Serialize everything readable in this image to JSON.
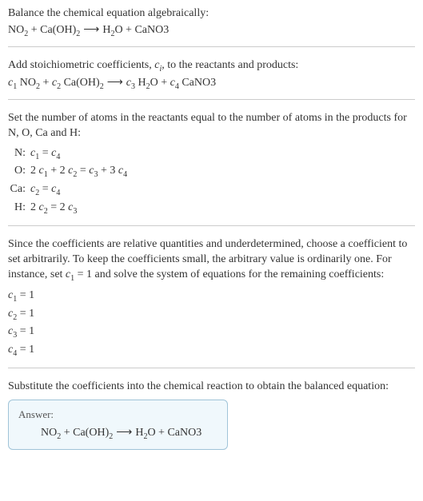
{
  "chart_data": {
    "type": "table",
    "title": "Balance chemical equation algebraically",
    "unbalanced": "NO2 + Ca(OH)2 -> H2O + CaNO3",
    "elements": [
      "N",
      "O",
      "Ca",
      "H"
    ],
    "equations": {
      "N": "c1 = c4",
      "O": "2 c1 + 2 c2 = c3 + 3 c4",
      "Ca": "c2 = c4",
      "H": "2 c2 = 2 c3"
    },
    "solution": {
      "c1": 1,
      "c2": 1,
      "c3": 1,
      "c4": 1
    },
    "balanced": "NO2 + Ca(OH)2 -> H2O + CaNO3"
  },
  "s1": {
    "intro": "Balance the chemical equation algebraically:",
    "eq_no2": "NO",
    "eq_no2_sub": "2",
    "plus1": " + Ca(OH)",
    "caoh_sub": "2",
    "arrow": " ⟶ ",
    "h2o_h": "H",
    "h2o_sub": "2",
    "h2o_o": "O + CaNO3"
  },
  "s2": {
    "intro_a": "Add stoichiometric coefficients, ",
    "ci": "c",
    "ci_sub": "i",
    "intro_b": ", to the reactants and products:",
    "c1": "c",
    "c1_sub": "1",
    "sp1": " NO",
    "no2_sub": "2",
    "plus": " + ",
    "c2": "c",
    "c2_sub": "2",
    "sp2": " Ca(OH)",
    "caoh_sub": "2",
    "arrow": " ⟶ ",
    "c3": "c",
    "c3_sub": "3",
    "sp3": " H",
    "h2_sub": "2",
    "sp3b": "O + ",
    "c4": "c",
    "c4_sub": "4",
    "sp4": " CaNO3"
  },
  "s3": {
    "intro": "Set the number of atoms in the reactants equal to the number of atoms in the products for N, O, Ca and H:",
    "rows": {
      "N": {
        "label": "N:",
        "lhs_c": "c",
        "lhs_s": "1",
        "mid": " = ",
        "rhs_c": "c",
        "rhs_s": "4"
      },
      "O": {
        "label": "O:",
        "t1": "2 ",
        "c1": "c",
        "s1": "1",
        "t2": " + 2 ",
        "c2": "c",
        "s2": "2",
        "t3": " = ",
        "c3": "c",
        "s3": "3",
        "t4": " + 3 ",
        "c4": "c",
        "s4": "4"
      },
      "Ca": {
        "label": "Ca:",
        "lhs_c": "c",
        "lhs_s": "2",
        "mid": " = ",
        "rhs_c": "c",
        "rhs_s": "4"
      },
      "H": {
        "label": "H:",
        "t1": "2 ",
        "c1": "c",
        "s1": "2",
        "t2": " = 2 ",
        "c2": "c",
        "s2": "3"
      }
    }
  },
  "s4": {
    "intro_a": "Since the coefficients are relative quantities and underdetermined, choose a coefficient to set arbitrarily. To keep the coefficients small, the arbitrary value is ordinarily one. For instance, set ",
    "c1": "c",
    "c1_sub": "1",
    "intro_b": " = 1 and solve the system of equations for the remaining coefficients:",
    "lines": {
      "l1": {
        "c": "c",
        "s": "1",
        "rest": " = 1"
      },
      "l2": {
        "c": "c",
        "s": "2",
        "rest": " = 1"
      },
      "l3": {
        "c": "c",
        "s": "3",
        "rest": " = 1"
      },
      "l4": {
        "c": "c",
        "s": "4",
        "rest": " = 1"
      }
    }
  },
  "s5": {
    "intro": "Substitute the coefficients into the chemical reaction to obtain the balanced equation:",
    "answer_label": "Answer:",
    "eq_no2": "NO",
    "eq_no2_sub": "2",
    "plus1": " + Ca(OH)",
    "caoh_sub": "2",
    "arrow": " ⟶ ",
    "h2o_h": "H",
    "h2o_sub": "2",
    "h2o_o": "O + CaNO3"
  }
}
